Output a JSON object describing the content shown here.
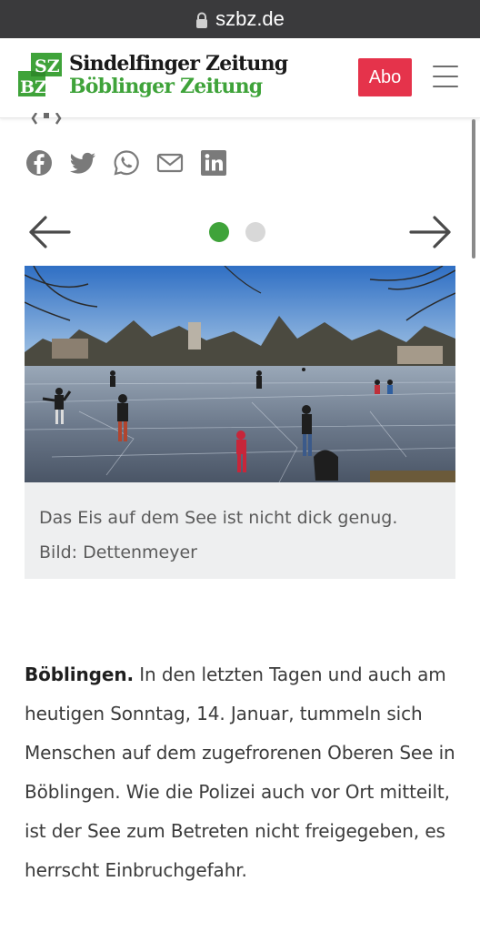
{
  "browser": {
    "url": "szbz.de"
  },
  "header": {
    "logo_line1": "Sindelfinger Zeitung",
    "logo_line2": "Böblinger Zeitung",
    "logo_mark": "SZ BZ",
    "abo_label": "Abo",
    "brand_green": "#3fa33a",
    "abo_color": "#e5334b"
  },
  "share": {
    "icons": [
      "facebook-icon",
      "twitter-icon",
      "whatsapp-icon",
      "mail-icon",
      "linkedin-icon"
    ]
  },
  "gallery": {
    "total_slides": 2,
    "active_slide": 1,
    "prev_icon": "arrow-left-icon",
    "next_icon": "arrow-right-icon",
    "caption": "Das Eis auf dem See ist nicht dick genug. Bild: Dettenmeyer"
  },
  "article": {
    "dateline": "Böblingen.",
    "body": " In den letzten Tagen und auch am heutigen Sonntag, 14. Januar, tummeln sich Menschen auf dem zugefrorenen Oberen See in Böblingen. Wie die Polizei auch vor Ort mitteilt, ist der See zum Betreten nicht freigegeben, es herrscht Einbruchgefahr."
  }
}
